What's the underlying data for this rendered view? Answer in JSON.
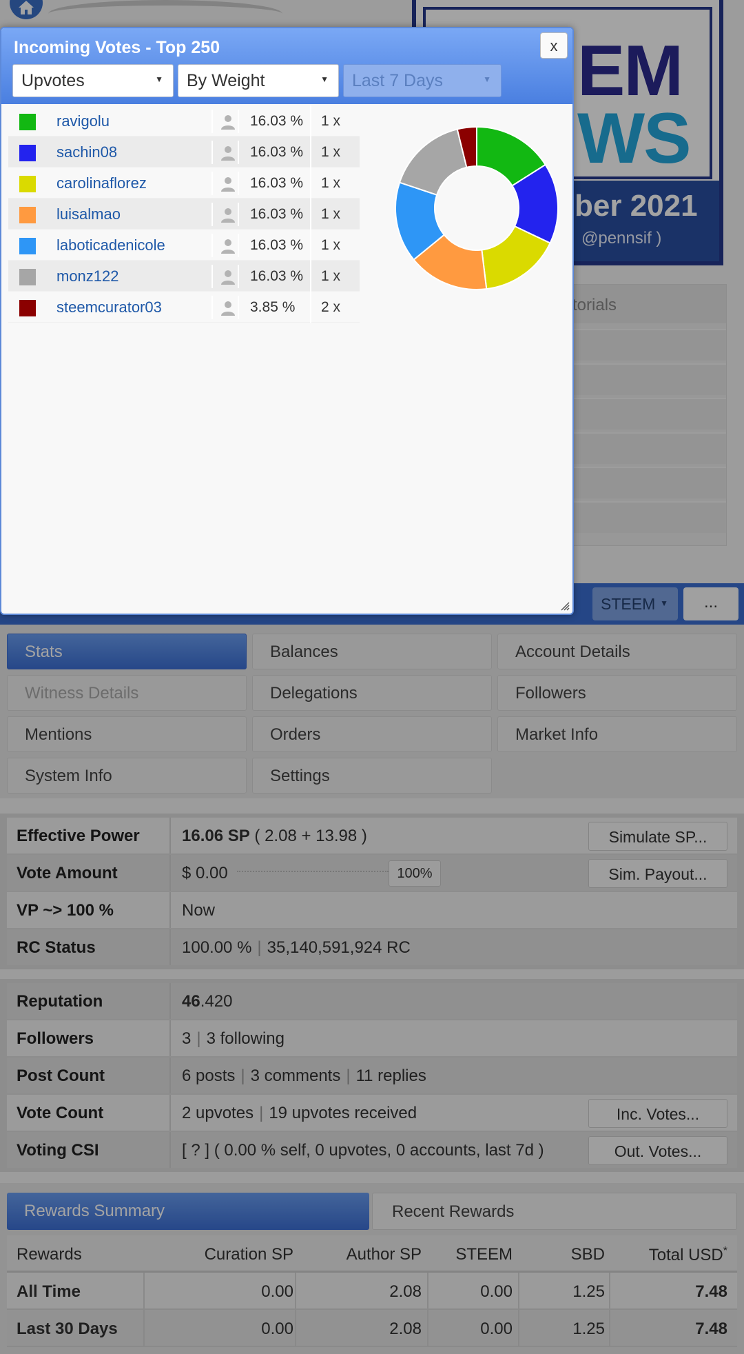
{
  "banner": {
    "big_line1": "EM",
    "big_line2": "WS",
    "date_fragment": "ber 2021",
    "user_fragment": "@pennsif )"
  },
  "side_panel": {
    "tab_fragment": "torials"
  },
  "toolbar": {
    "currency": "STEEM",
    "more_label": "..."
  },
  "nav": {
    "buttons": [
      {
        "label": "Stats",
        "state": "active"
      },
      {
        "label": "Balances",
        "state": "normal"
      },
      {
        "label": "Account Details",
        "state": "normal"
      },
      {
        "label": "Witness Details",
        "state": "disabled"
      },
      {
        "label": "Delegations",
        "state": "normal"
      },
      {
        "label": "Followers",
        "state": "normal"
      },
      {
        "label": "Mentions",
        "state": "normal"
      },
      {
        "label": "Orders",
        "state": "normal"
      },
      {
        "label": "Market Info",
        "state": "normal"
      },
      {
        "label": "System Info",
        "state": "normal"
      },
      {
        "label": "Settings",
        "state": "normal"
      }
    ]
  },
  "stats": {
    "effective_power": {
      "label": "Effective Power",
      "value_bold": "16.06 SP",
      "value_rest": " ( 2.08 + 13.98 )",
      "button": "Simulate SP..."
    },
    "vote_amount": {
      "label": "Vote Amount",
      "value": "$ 0.00",
      "percent": "100%",
      "button": "Sim. Payout..."
    },
    "vp": {
      "label": "VP ~> 100 %",
      "value": "Now"
    },
    "rc": {
      "label": "RC Status",
      "value1": "100.00 %",
      "value2": "35,140,591,924 RC"
    },
    "reputation": {
      "label": "Reputation",
      "value_bold": "46",
      "value_rest": ".420"
    },
    "followers": {
      "label": "Followers",
      "value1": "3",
      "value2": "3 following"
    },
    "post_count": {
      "label": "Post Count",
      "value1": "6 posts",
      "value2": "3 comments",
      "value3": "11 replies"
    },
    "vote_count": {
      "label": "Vote Count",
      "value1": "2 upvotes",
      "value2": "19 upvotes received",
      "button": "Inc. Votes..."
    },
    "voting_csi": {
      "label": "Voting CSI",
      "value": "[ ? ] ( 0.00 % self, 0 upvotes, 0 accounts, last 7d )",
      "button": "Out. Votes..."
    }
  },
  "rewards_tabs": {
    "active": "Rewards Summary",
    "inactive": "Recent Rewards"
  },
  "rewards": {
    "headers": [
      "Rewards",
      "Curation SP",
      "Author SP",
      "STEEM",
      "SBD",
      "Total USD"
    ],
    "total_usd_mark": "*",
    "rows": [
      [
        "All Time",
        "0.00",
        "2.08",
        "0.00",
        "1.25",
        "7.48"
      ],
      [
        "Last 30 Days",
        "0.00",
        "2.08",
        "0.00",
        "1.25",
        "7.48"
      ]
    ]
  },
  "modal": {
    "title": "Incoming Votes - Top 250",
    "close_label": "x",
    "filter_type": "Upvotes",
    "sort_by": "By Weight",
    "period": "Last 7 Days",
    "voters": [
      {
        "name": "ravigolu",
        "percent": "16.03 %",
        "count": "1 x",
        "color": "#12b812"
      },
      {
        "name": "sachin08",
        "percent": "16.03 %",
        "count": "1 x",
        "color": "#2323ee"
      },
      {
        "name": "carolinaflorez",
        "percent": "16.03 %",
        "count": "1 x",
        "color": "#dada00"
      },
      {
        "name": "luisalmao",
        "percent": "16.03 %",
        "count": "1 x",
        "color": "#ff9a40"
      },
      {
        "name": "laboticadenicole",
        "percent": "16.03 %",
        "count": "1 x",
        "color": "#2e96f6"
      },
      {
        "name": "monz122",
        "percent": "16.03 %",
        "count": "1 x",
        "color": "#a6a6a6"
      },
      {
        "name": "steemcurator03",
        "percent": "3.85 %",
        "count": "2 x",
        "color": "#8b0000"
      }
    ]
  },
  "chart_data": {
    "type": "pie",
    "style": "donut",
    "categories": [
      "ravigolu",
      "sachin08",
      "carolinaflorez",
      "luisalmao",
      "laboticadenicole",
      "monz122",
      "steemcurator03"
    ],
    "values": [
      16.03,
      16.03,
      16.03,
      16.03,
      16.03,
      16.03,
      3.85
    ],
    "colors": [
      "#12b812",
      "#2323ee",
      "#dada00",
      "#ff9a40",
      "#2e96f6",
      "#a6a6a6",
      "#8b0000"
    ],
    "legend": "left"
  }
}
